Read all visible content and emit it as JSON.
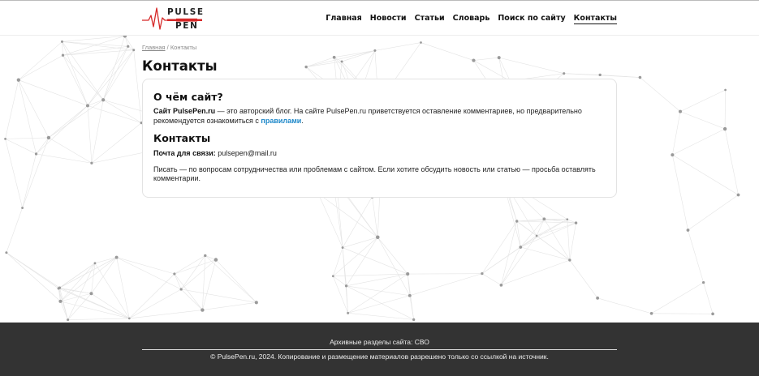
{
  "brand": {
    "logo_line1": "PULSE",
    "logo_line2": "PEN",
    "accent_red": "#d62828",
    "link_blue": "#1e88c9",
    "footer_bg": "#333333"
  },
  "nav": {
    "items": [
      {
        "label": "Главная"
      },
      {
        "label": "Новости"
      },
      {
        "label": "Статьи"
      },
      {
        "label": "Словарь"
      },
      {
        "label": "Поиск по сайту"
      },
      {
        "label": "Контакты",
        "active": true
      }
    ]
  },
  "breadcrumb": {
    "home": "Главная",
    "separator": " / ",
    "current": "Контакты"
  },
  "page": {
    "title": "Контакты"
  },
  "card": {
    "about_heading": "О чём сайт?",
    "about_bold": "Сайт PulsePen.ru",
    "about_text": " — это авторский блог. На сайте PulsePen.ru приветствуется оставление комментариев, но предварительно рекомендуется ознакомиться с ",
    "rules_link": "правилами",
    "about_end": ".",
    "contacts_heading": "Контакты",
    "mail_label": "Почта для связи:",
    "mail_value": " pulsepen@mail.ru",
    "write_text": "Писать — по вопросам сотрудничества или проблемам с сайтом. Если хотите обсудить новость или статью — просьба оставлять комментарии."
  },
  "footer": {
    "archive": "Архивные разделы сайта: СВО",
    "copyright": "© PulsePen.ru, 2024. Копирование и размещение материалов разрешено только со ссылкой на источник."
  }
}
